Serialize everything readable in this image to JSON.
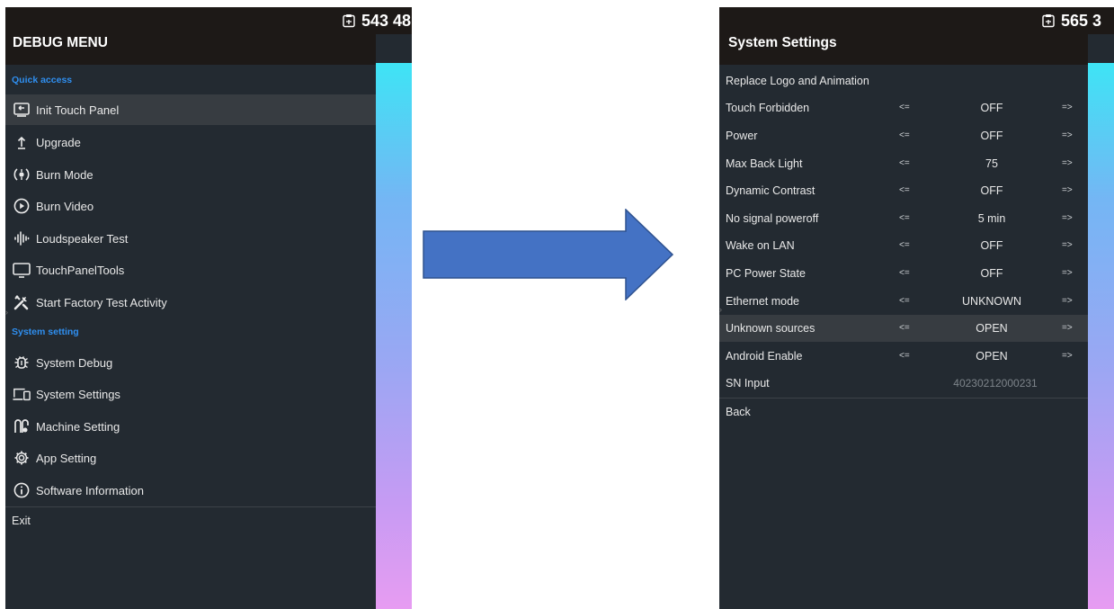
{
  "left_screen": {
    "title": "DEBUG MENU",
    "badge_value": "543 48",
    "quick_access": {
      "header": "Quick access",
      "items": [
        {
          "label": "Init Touch Panel",
          "icon": "touch-panel-icon"
        },
        {
          "label": "Upgrade",
          "icon": "upload-icon"
        },
        {
          "label": "Burn Mode",
          "icon": "burn-mode-icon"
        },
        {
          "label": "Burn Video",
          "icon": "play-circle-icon"
        },
        {
          "label": "Loudspeaker Test",
          "icon": "audio-wave-icon"
        },
        {
          "label": "TouchPanelTools",
          "icon": "monitor-icon"
        },
        {
          "label": "Start Factory Test Activity",
          "icon": "tools-icon"
        }
      ]
    },
    "system_setting": {
      "header": "System setting",
      "items": [
        {
          "label": "System Debug",
          "icon": "bug-icon"
        },
        {
          "label": "System Settings",
          "icon": "devices-icon"
        },
        {
          "label": "Machine Setting",
          "icon": "machine-icon"
        },
        {
          "label": "App Setting",
          "icon": "gear-icon"
        },
        {
          "label": "Software Information",
          "icon": "info-icon"
        }
      ]
    },
    "exit_label": "Exit"
  },
  "right_screen": {
    "title": "System Settings",
    "badge_value": "565 3",
    "top_item": "Replace Logo and Animation",
    "left_arrow": "<=",
    "right_arrow": "=>",
    "settings": [
      {
        "label": "Touch Forbidden",
        "value": "OFF"
      },
      {
        "label": "Power",
        "value": "OFF"
      },
      {
        "label": "Max Back Light",
        "value": "75"
      },
      {
        "label": "Dynamic Contrast",
        "value": "OFF"
      },
      {
        "label": "No signal poweroff",
        "value": "5 min"
      },
      {
        "label": "Wake on LAN",
        "value": "OFF"
      },
      {
        "label": "PC Power State",
        "value": "OFF"
      },
      {
        "label": "Ethernet mode",
        "value": "UNKNOWN"
      },
      {
        "label": "Unknown sources",
        "value": "OPEN"
      },
      {
        "label": "Android Enable",
        "value": "OPEN"
      }
    ],
    "sn": {
      "label": "SN Input",
      "value": "40230212000231"
    },
    "back_label": "Back"
  },
  "colors": {
    "panel_bg": "#232a31",
    "title_bg": "#1d1917",
    "section_header": "#2f8ff0",
    "highlight_row": "#373c41",
    "arrow_fill": "#4472c4",
    "arrow_stroke": "#2f528f"
  }
}
